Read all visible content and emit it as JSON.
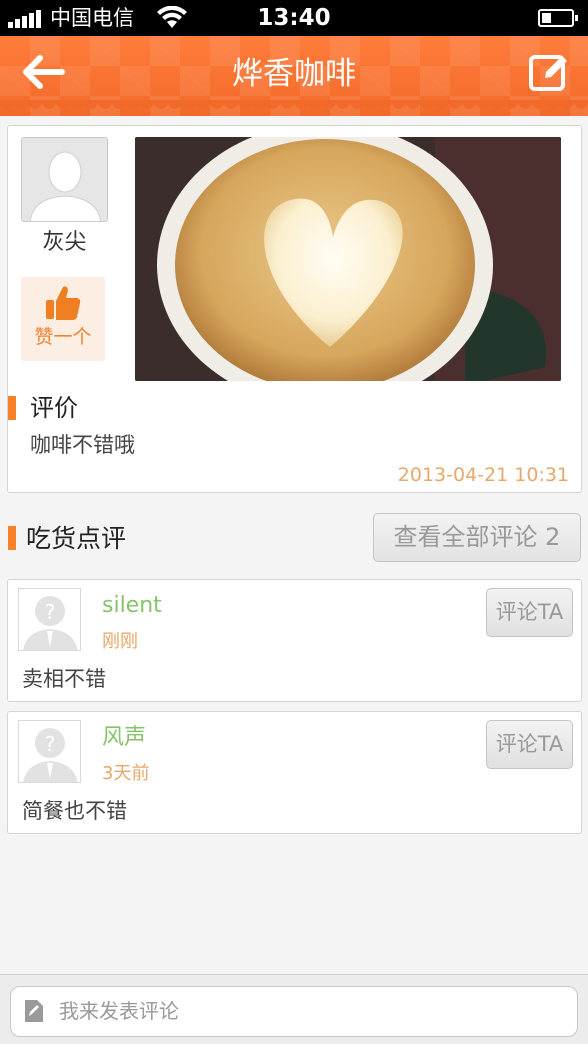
{
  "status_bar": {
    "carrier": "中国电信",
    "time": "13:40"
  },
  "nav": {
    "title": "烨香咖啡",
    "back_icon": "arrow-left-icon",
    "edit_icon": "compose-icon"
  },
  "post": {
    "author": "灰尖",
    "like_label": "赞一个",
    "review_heading": "评价",
    "review_text": "咖啡不错哦",
    "timestamp": "2013-04-21 10:31"
  },
  "comments_section": {
    "heading": "吃货点评",
    "view_all_label": "查看全部评论 2"
  },
  "comments": [
    {
      "user": "silent",
      "time": "刚刚",
      "text": "卖相不错",
      "reply_label": "评论TA"
    },
    {
      "user": "风声",
      "time": "3天前",
      "text": "简餐也不错",
      "reply_label": "评论TA"
    }
  ],
  "composer": {
    "placeholder": "我来发表评论"
  },
  "colors": {
    "brand_orange": "#f26a2a",
    "accent_mark": "#f5822a",
    "username_green": "#86c36a",
    "timestamp_tan": "#e8a86a"
  }
}
